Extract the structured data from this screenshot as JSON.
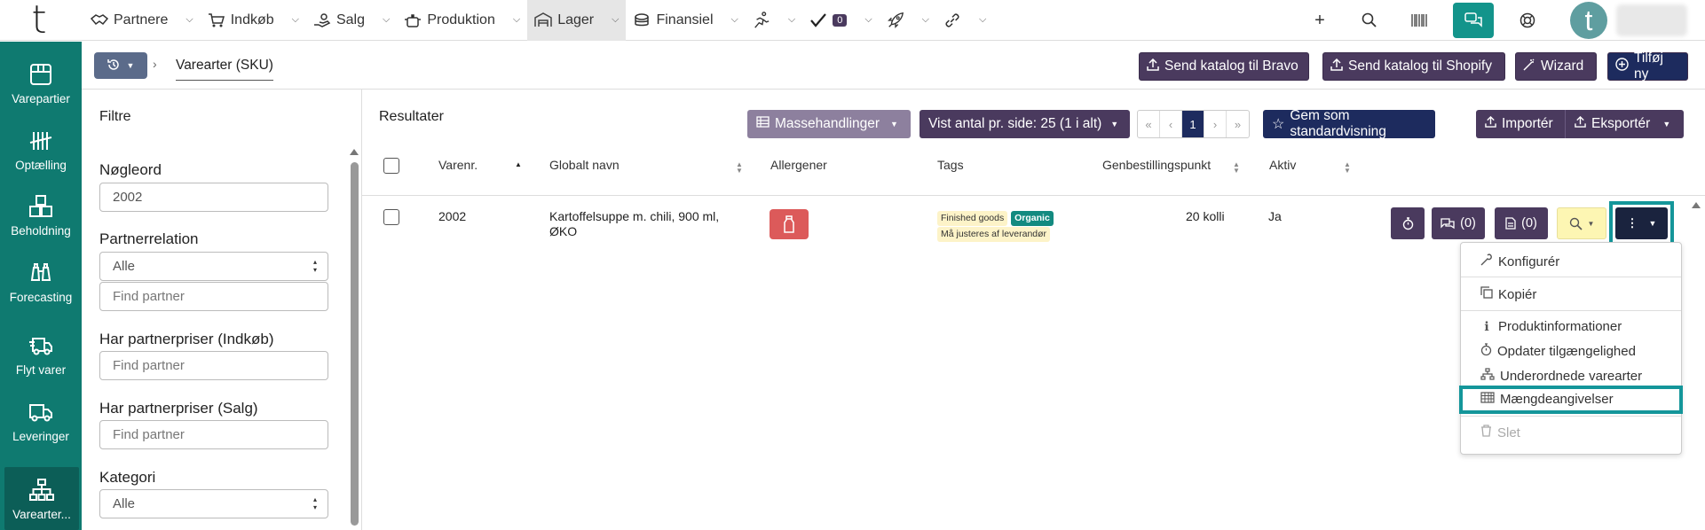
{
  "logo": "t",
  "nav": {
    "items": [
      {
        "label": "Partnere",
        "icon": "handshake-icon"
      },
      {
        "label": "Indkøb",
        "icon": "cart-icon"
      },
      {
        "label": "Salg",
        "icon": "hand-coins-icon"
      },
      {
        "label": "Produktion",
        "icon": "pot-icon"
      },
      {
        "label": "Lager",
        "icon": "warehouse-icon"
      },
      {
        "label": "Finansiel",
        "icon": "coins-icon"
      }
    ],
    "task_count": "0"
  },
  "sidebar": {
    "items": [
      {
        "label": "Varepartier",
        "icon": "box-icon"
      },
      {
        "label": "Optælling",
        "icon": "tally-icon"
      },
      {
        "label": "Beholdning",
        "icon": "boxes-icon"
      },
      {
        "label": "Forecasting",
        "icon": "binoculars-icon"
      },
      {
        "label": "Flyt varer",
        "icon": "truck-fast-icon"
      },
      {
        "label": "Leveringer",
        "icon": "truck-icon"
      },
      {
        "label": "Varearter...",
        "icon": "sitemap-icon"
      }
    ]
  },
  "header": {
    "breadcrumb": "Varearter (SKU)",
    "buttons": {
      "bravo": "Send katalog til Bravo",
      "shopify": "Send katalog til Shopify",
      "wizard": "Wizard",
      "add": "Tilføj ny"
    }
  },
  "filters": {
    "title": "Filtre",
    "keyword_label": "Nøgleord",
    "keyword_value": "2002",
    "partner_relation_label": "Partnerrelation",
    "partner_relation_value": "Alle",
    "find_partner_placeholder": "Find partner",
    "purchase_prices_label": "Har partnerpriser (Indkøb)",
    "sales_prices_label": "Har partnerpriser (Salg)",
    "category_label": "Kategori",
    "category_value": "Alle"
  },
  "results": {
    "title": "Resultater",
    "bulk_actions": "Massehandlinger",
    "per_page": "Vist antal pr. side: 25 (1 i alt)",
    "pager": [
      "«",
      "‹",
      "1",
      "›",
      "»"
    ],
    "save_default": "Gem som standardvisning",
    "import": "Importér",
    "export": "Eksportér",
    "columns": [
      "Varenr.",
      "Globalt navn",
      "Allergener",
      "Tags",
      "Genbestillingspunkt",
      "Aktiv"
    ],
    "rows": [
      {
        "number": "2002",
        "name_line1": "Kartoffelsuppe m. chili, 900 ml,",
        "name_line2": "ØKO",
        "tags": [
          "Finished goods",
          "Organic",
          "Må justeres af leverandør"
        ],
        "reorder_point": "20 kolli",
        "active": "Ja",
        "comments": "(0)",
        "documents": "(0)"
      }
    ]
  },
  "menu": {
    "items": [
      "Konfigurér",
      "Kopiér",
      "Produktinformationer",
      "Opdater tilgængelighed",
      "Underordnede varearter",
      "Mængdeangivelser",
      "Slet"
    ]
  }
}
